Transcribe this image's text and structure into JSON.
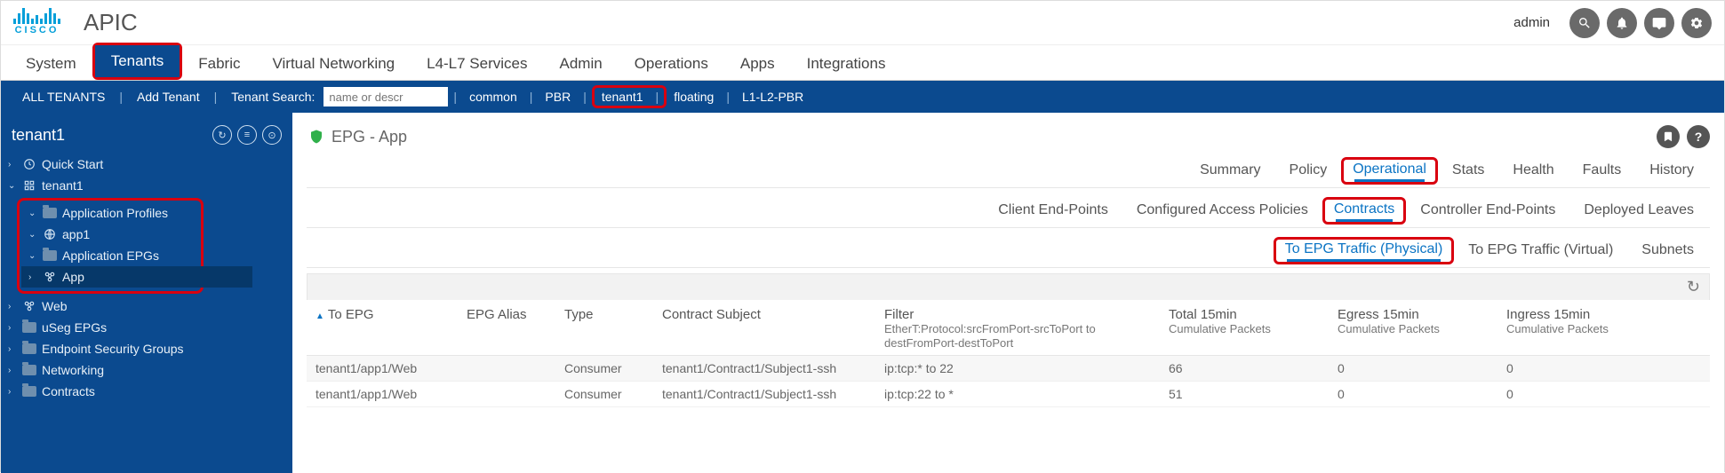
{
  "brand": {
    "name": "CISCO",
    "app": "APIC"
  },
  "user": "admin",
  "mainnav": {
    "items": [
      "System",
      "Tenants",
      "Fabric",
      "Virtual Networking",
      "L4-L7 Services",
      "Admin",
      "Operations",
      "Apps",
      "Integrations"
    ],
    "active": "Tenants"
  },
  "subnav": {
    "all_tenants": "ALL TENANTS",
    "add_tenant": "Add Tenant",
    "search_label": "Tenant Search:",
    "search_placeholder": "name or descr",
    "tenants": [
      "common",
      "PBR",
      "tenant1",
      "floating",
      "L1-L2-PBR"
    ],
    "highlight": "tenant1"
  },
  "sidebar": {
    "tenant": "tenant1",
    "quick_start": "Quick Start",
    "tenant_node": "tenant1",
    "app_profiles": "Application Profiles",
    "app1": "app1",
    "app_epgs": "Application EPGs",
    "epg_app": "App",
    "epg_web": "Web",
    "useg": "uSeg EPGs",
    "esg": "Endpoint Security Groups",
    "networking": "Networking",
    "contracts": "Contracts"
  },
  "page": {
    "title": "EPG - App",
    "tabs1": [
      "Summary",
      "Policy",
      "Operational",
      "Stats",
      "Health",
      "Faults",
      "History"
    ],
    "tabs1_active": "Operational",
    "tabs2": [
      "Client End-Points",
      "Configured Access Policies",
      "Contracts",
      "Controller End-Points",
      "Deployed Leaves"
    ],
    "tabs2_active": "Contracts",
    "tabs3": [
      "To EPG Traffic (Physical)",
      "To EPG Traffic (Virtual)",
      "Subnets"
    ],
    "tabs3_active": "To EPG Traffic (Physical)"
  },
  "table": {
    "cols": {
      "to_epg": "To EPG",
      "alias": "EPG Alias",
      "type": "Type",
      "subject": "Contract Subject",
      "filter": "Filter",
      "filter_sub": "EtherT:Protocol:srcFromPort-srcToPort to destFromPort-destToPort",
      "total": "Total 15min",
      "total_sub": "Cumulative Packets",
      "egress": "Egress 15min",
      "egress_sub": "Cumulative Packets",
      "ingress": "Ingress 15min",
      "ingress_sub": "Cumulative Packets"
    },
    "rows": [
      {
        "to_epg": "tenant1/app1/Web",
        "alias": "",
        "type": "Consumer",
        "subject": "tenant1/Contract1/Subject1-ssh",
        "filter": "ip:tcp:* to 22",
        "total": "66",
        "egress": "0",
        "ingress": "0"
      },
      {
        "to_epg": "tenant1/app1/Web",
        "alias": "",
        "type": "Consumer",
        "subject": "tenant1/Contract1/Subject1-ssh",
        "filter": "ip:tcp:22 to *",
        "total": "51",
        "egress": "0",
        "ingress": "0"
      }
    ]
  }
}
